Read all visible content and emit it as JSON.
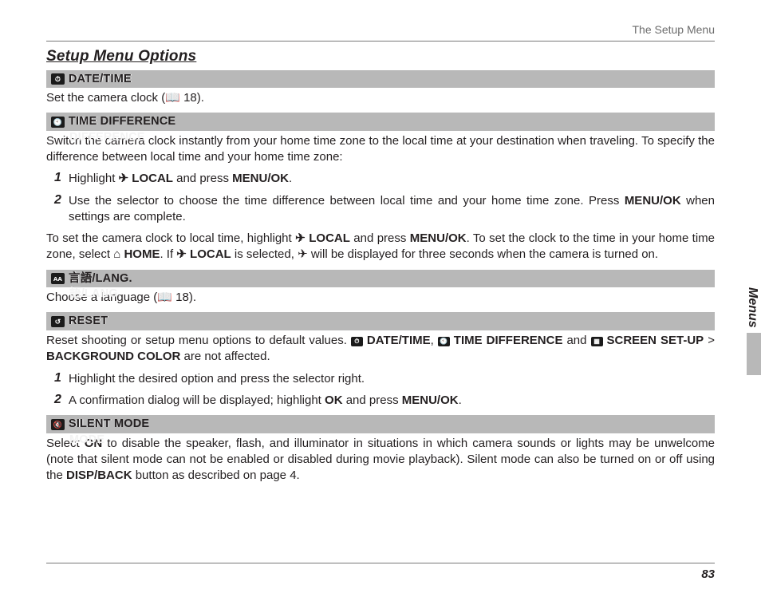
{
  "header": {
    "breadcrumb": "The Setup Menu"
  },
  "title": "Setup Menu Options",
  "sections": {
    "date": {
      "icon": "⏱",
      "label": "DATE/TIME",
      "body_pre": "Set the camera clock (",
      "body_ref": " 18).",
      "book": "📖"
    },
    "tdiff": {
      "icon": "🕙",
      "label": "TIME DIFFERENCE",
      "intro": "Switch the camera clock instantly from your home time zone to the local time at your destination when traveling.  To specify the difference between local time and your home time zone:",
      "step1_a": "Highlight ",
      "local_icon": "✈",
      "local_word": " LOCAL",
      "step1_b": " and press ",
      "menuok": "MENU/OK",
      "step1_c": ".",
      "step2_a": "Use the selector to choose the time difference between local time and your home time zone.  Press ",
      "step2_b": " when settings are complete.",
      "para2_a": "To set the camera clock to local time, highlight ",
      "para2_b": " and press ",
      "para2_c": ".  To set the clock to the time in your home time zone, select ",
      "home_icon": "⌂",
      "home_word": " HOME",
      "para2_d": ".  If ",
      "para2_e": " is selected, ",
      "para2_f": " will be displayed for three seconds when the camera is turned on."
    },
    "lang": {
      "icon": "ᴀᴀ",
      "label": "言語/LANG.",
      "body_pre": "Choose a language (",
      "body_ref": " 18).",
      "book": "📖"
    },
    "reset": {
      "icon": "↺",
      "label": "RESET",
      "para_a": "Reset shooting or setup menu options to default values. ",
      "date_icon": "⏱",
      "date_lbl": " DATE/TIME",
      "para_b": ", ",
      "td_icon": "🕙",
      "td_lbl": " TIME DIFFERENCE",
      "para_c": " and ",
      "ss_icon": "▦",
      "ss_lbl": " SCREEN SET-UP",
      "para_d": " > ",
      "bg_lbl": "BACKGROUND COLOR",
      "para_e": " are not affected.",
      "step1": "Highlight the desired option and press the selector right.",
      "step2_a": "A confirmation dialog will be displayed; highlight ",
      "ok": "OK",
      "step2_b": " and press ",
      "menuok": "MENU/OK",
      "step2_c": "."
    },
    "silent": {
      "icon": "🔇",
      "label": "SILENT MODE",
      "para_a": "Select ",
      "on": "ON",
      "para_b": " to disable the speaker, flash, and illuminator in situations in which camera sounds or lights may be unwelcome (note that silent mode can not be enabled or disabled during movie playback). Silent mode can also be turned on or off using the ",
      "disp": "DISP/BACK",
      "para_c": " button as described on page 4."
    }
  },
  "sidetab": "Menus",
  "page_number": "83",
  "steps": {
    "one": "1",
    "two": "2"
  }
}
